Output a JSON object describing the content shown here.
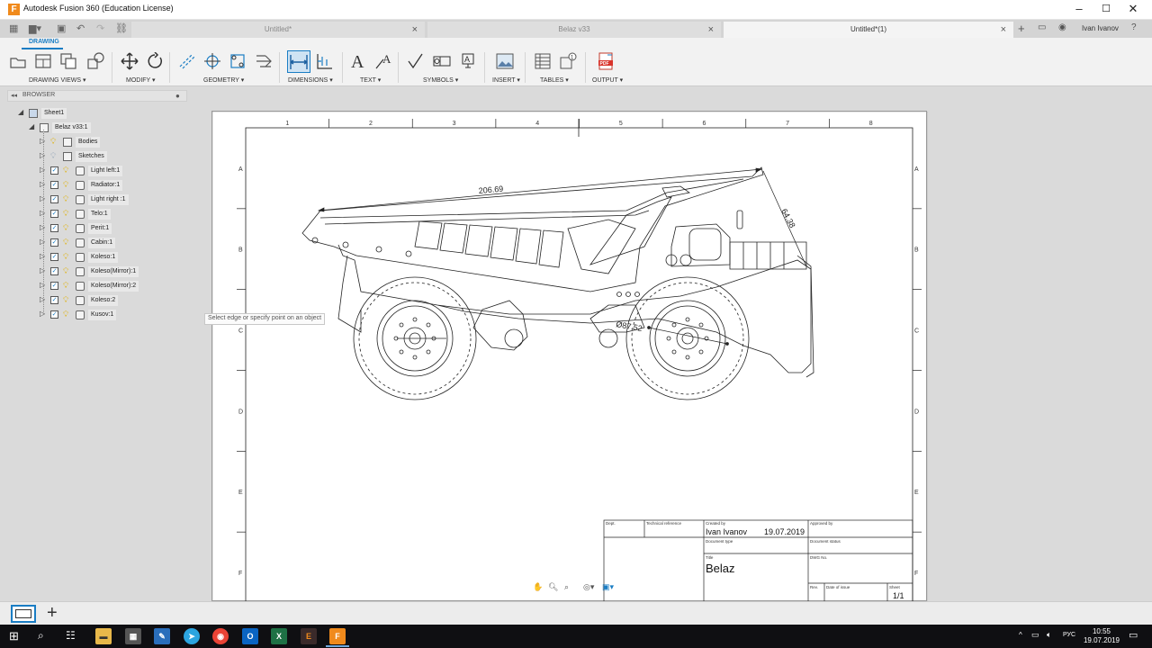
{
  "window": {
    "title": "Autodesk Fusion 360 (Education License)"
  },
  "tabs": [
    {
      "label": "Untitled*"
    },
    {
      "label": "Belaz v33"
    },
    {
      "label": "Untitled*(1)"
    }
  ],
  "user": {
    "name": "Ivan Ivanov"
  },
  "ribbon": {
    "workspace_tab": "DRAWING",
    "groups": [
      "DRAWING VIEWS",
      "MODIFY",
      "GEOMETRY",
      "DIMENSIONS",
      "TEXT",
      "SYMBOLS",
      "INSERT",
      "TABLES",
      "OUTPUT"
    ]
  },
  "browser": {
    "title": "BROWSER",
    "items": [
      {
        "label": "Sheet1"
      },
      {
        "label": "Belaz v33:1"
      },
      {
        "label": "Bodies"
      },
      {
        "label": "Sketches"
      },
      {
        "label": "Light left:1"
      },
      {
        "label": "Radiator:1"
      },
      {
        "label": "Light right :1"
      },
      {
        "label": "Telo:1"
      },
      {
        "label": "Perit:1"
      },
      {
        "label": "Cabin:1"
      },
      {
        "label": "Koleso:1"
      },
      {
        "label": "Koleso(Mirror):1"
      },
      {
        "label": "Koleso(Mirror):2"
      },
      {
        "label": "Koleso:2"
      },
      {
        "label": "Kusov:1"
      }
    ]
  },
  "sheet": {
    "col_labels": [
      "1",
      "2",
      "3",
      "4",
      "5",
      "6",
      "7",
      "8"
    ],
    "row_labels": [
      "A",
      "B",
      "C",
      "D",
      "E",
      "F"
    ],
    "dimensions": {
      "length": "206.69",
      "angle": "64.38",
      "diameter": "Ø87.52"
    },
    "title_block": {
      "dept_label": "Dept.",
      "tech_ref_label": "Technical reference",
      "created_by_label": "Created by",
      "created_by": "Ivan Ivanov",
      "date": "19.07.2019",
      "approved_by_label": "Approved by",
      "doc_type_label": "Document type",
      "doc_status_label": "Document status",
      "title_label": "Title",
      "title": "Belaz",
      "dwg_no_label": "DWG No.",
      "rev_label": "Rev.",
      "date_of_issue_label": "Date of issue",
      "sheet_label": "Sheet",
      "sheet_value": "1/1"
    }
  },
  "hint": "Select edge or specify point on an object",
  "taskbar": {
    "tray_lang": "РУС",
    "time": "10:55",
    "date": "19.07.2019"
  },
  "colors": {
    "accent": "#1a7dc4",
    "fusion_orange": "#f08a1c"
  }
}
